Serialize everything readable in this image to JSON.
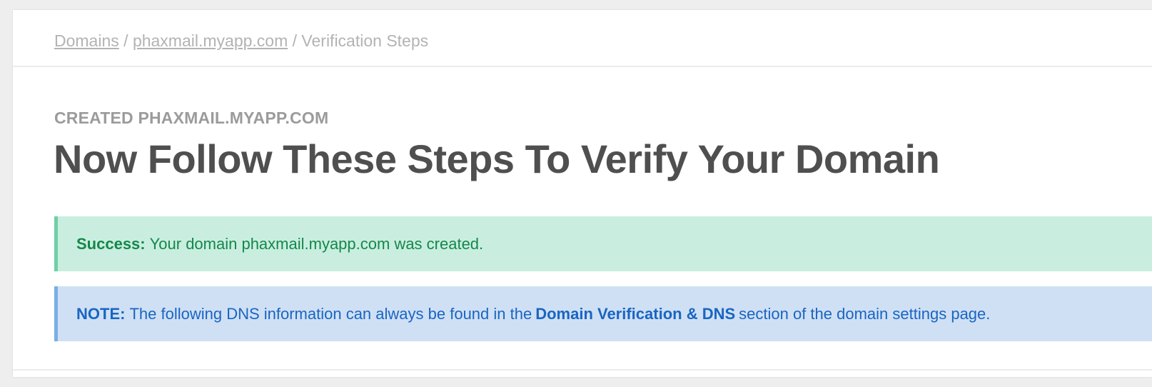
{
  "breadcrumb": {
    "items": [
      {
        "label": "Domains"
      },
      {
        "label": "phaxmail.myapp.com"
      }
    ],
    "separator": "/",
    "current": "Verification Steps"
  },
  "header": {
    "eyebrow": "CREATED PHAXMAIL.MYAPP.COM",
    "title": "Now Follow These Steps To Verify Your Domain"
  },
  "alerts": {
    "success": {
      "label": "Success:",
      "message": "Your domain phaxmail.myapp.com was created."
    },
    "note": {
      "label": "NOTE:",
      "message_before": "The following DNS information can always be found in the",
      "bold": "Domain Verification & DNS",
      "message_after": "section of the domain settings page."
    }
  },
  "colors": {
    "success_bg": "#c9eee0",
    "success_border": "#6fd0a6",
    "success_text": "#15874b",
    "note_bg": "#cfe0f5",
    "note_border": "#7aaee4",
    "note_text": "#1a65c1",
    "title_text": "#4f4f4f",
    "muted_text": "#9b9b9b"
  }
}
